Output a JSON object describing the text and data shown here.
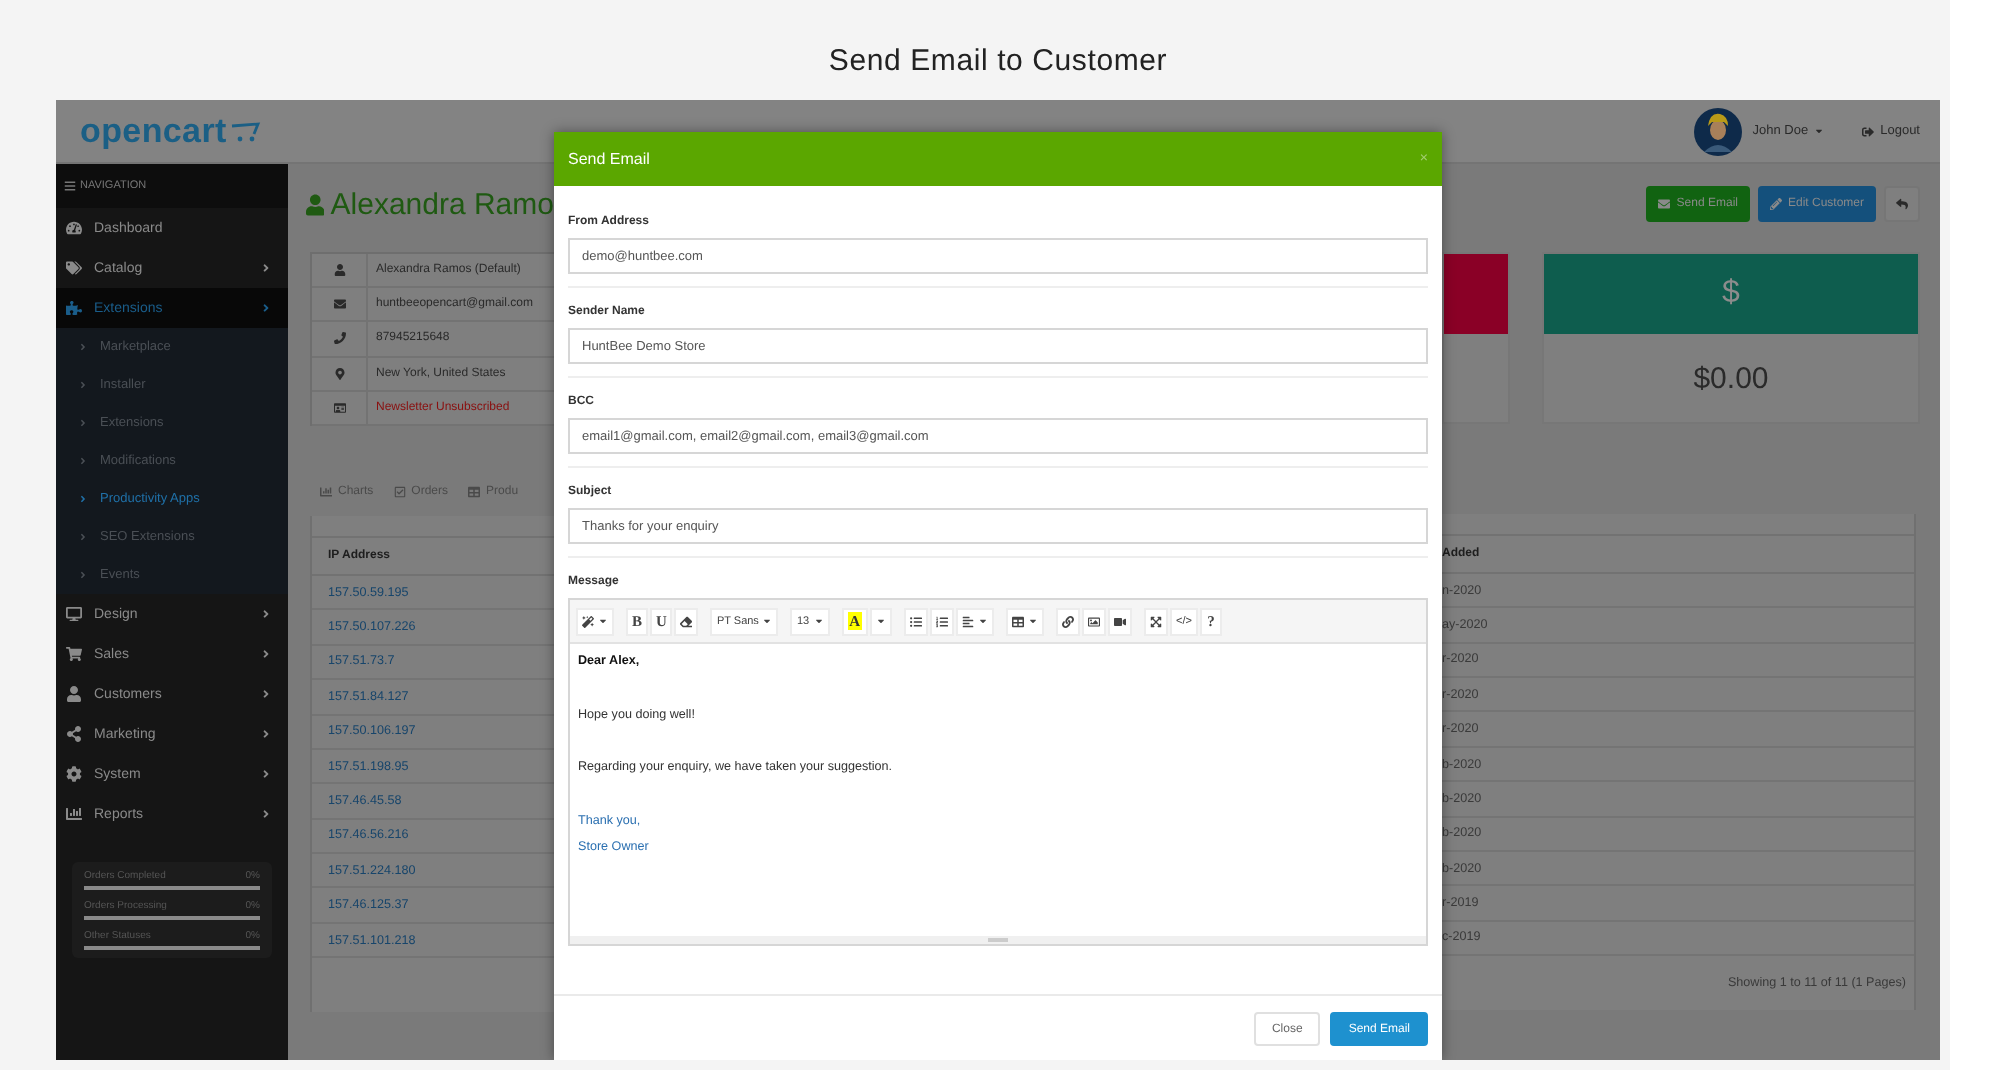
{
  "page_title": "Send Email to Customer",
  "header": {
    "logo": "opencart",
    "user": "John Doe",
    "logout": "Logout"
  },
  "sidebar": {
    "heading": "NAVIGATION",
    "items": [
      {
        "label": "Dashboard",
        "kind": "link",
        "selected": false
      },
      {
        "label": "Catalog",
        "kind": "menu",
        "selected": false
      },
      {
        "label": "Extensions",
        "kind": "menu",
        "selected": true,
        "children": [
          {
            "label": "Marketplace",
            "selected": false
          },
          {
            "label": "Installer",
            "selected": false
          },
          {
            "label": "Extensions",
            "selected": false
          },
          {
            "label": "Modifications",
            "selected": false
          },
          {
            "label": "Productivity Apps",
            "selected": true
          },
          {
            "label": "SEO Extensions",
            "selected": false
          },
          {
            "label": "Events",
            "selected": false
          }
        ]
      },
      {
        "label": "Design",
        "kind": "menu",
        "selected": false
      },
      {
        "label": "Sales",
        "kind": "menu",
        "selected": false
      },
      {
        "label": "Customers",
        "kind": "menu",
        "selected": false
      },
      {
        "label": "Marketing",
        "kind": "menu",
        "selected": false
      },
      {
        "label": "System",
        "kind": "menu",
        "selected": false
      },
      {
        "label": "Reports",
        "kind": "menu",
        "selected": false
      }
    ],
    "stats": [
      {
        "label": "Orders Completed",
        "value": "0%"
      },
      {
        "label": "Orders Processing",
        "value": "0%"
      },
      {
        "label": "Other Statuses",
        "value": "0%"
      }
    ]
  },
  "customer": {
    "name": "Alexandra Ramo",
    "info": [
      {
        "text": "Alexandra Ramos (Default)",
        "kind": "text"
      },
      {
        "text": "huntbeeopencart@gmail.com",
        "kind": "text"
      },
      {
        "text": "87945215648",
        "kind": "text"
      },
      {
        "text": "New York, United States",
        "kind": "text"
      },
      {
        "text": "Newsletter Unsubscribed",
        "kind": "alert"
      }
    ]
  },
  "actions": [
    {
      "label": "Send Email",
      "kind": "success"
    },
    {
      "label": "Edit Customer",
      "kind": "primary"
    },
    {
      "kind": "back"
    }
  ],
  "cards": [
    {
      "color": "#8a0026"
    },
    {
      "color": "#0e5d4e",
      "symbol": "$",
      "value": "$0.00"
    }
  ],
  "tabs": [
    {
      "label": "Charts",
      "selected": false
    },
    {
      "label": "Orders",
      "selected": false
    },
    {
      "label": "Produ",
      "selected": false
    }
  ],
  "table": {
    "columns": [
      "IP Address",
      "Added"
    ],
    "rows": [
      [
        "157.50.59.195",
        "n-2020"
      ],
      [
        "157.50.107.226",
        "ay-2020"
      ],
      [
        "157.51.73.7",
        "r-2020"
      ],
      [
        "157.51.84.127",
        "r-2020"
      ],
      [
        "157.50.106.197",
        "r-2020"
      ],
      [
        "157.51.198.95",
        "b-2020"
      ],
      [
        "157.46.45.58",
        "b-2020"
      ],
      [
        "157.46.56.216",
        "b-2020"
      ],
      [
        "157.51.224.180",
        "b-2020"
      ],
      [
        "157.46.125.37",
        "r-2019"
      ],
      [
        "157.51.101.218",
        "c-2019"
      ]
    ],
    "footer": "Showing 1 to 11 of 11 (1 Pages)"
  },
  "modal": {
    "title": "Send Email",
    "close": "×",
    "fields": [
      {
        "label": "From Address",
        "value": "demo@huntbee.com"
      },
      {
        "label": "Sender Name",
        "value": "HuntBee Demo Store"
      },
      {
        "label": "BCC",
        "value": "email1@gmail.com, email2@gmail.com, email3@gmail.com"
      },
      {
        "label": "Subject",
        "value": "Thanks for your enquiry"
      }
    ],
    "message_label": "Message",
    "toolbar": [
      [
        {
          "kind": "style"
        }
      ],
      [
        {
          "kind": "bold",
          "label": "B"
        },
        {
          "kind": "underline",
          "label": "U"
        },
        {
          "kind": "eraser"
        }
      ],
      [
        {
          "kind": "font",
          "label": "PT Sans"
        }
      ],
      [
        {
          "kind": "size",
          "label": "13"
        }
      ],
      [
        {
          "kind": "color",
          "label": "A"
        },
        {
          "kind": "caret"
        }
      ],
      [
        {
          "kind": "ul"
        },
        {
          "kind": "ol"
        },
        {
          "kind": "align"
        }
      ],
      [
        {
          "kind": "table"
        }
      ],
      [
        {
          "kind": "link"
        },
        {
          "kind": "picture"
        },
        {
          "kind": "video"
        }
      ],
      [
        {
          "kind": "fullscreen"
        },
        {
          "kind": "code",
          "label": "</>"
        },
        {
          "kind": "help",
          "label": "?"
        }
      ]
    ],
    "message": {
      "greeting": "Dear Alex,",
      "paragraphs": [
        "Hope you doing well!",
        "Regarding your enquiry, we have taken your suggestion."
      ],
      "signature": [
        "Thank you,",
        "Store Owner"
      ]
    },
    "buttons": [
      {
        "label": "Close",
        "kind": "default"
      },
      {
        "label": "Send Email",
        "kind": "primary"
      }
    ]
  }
}
